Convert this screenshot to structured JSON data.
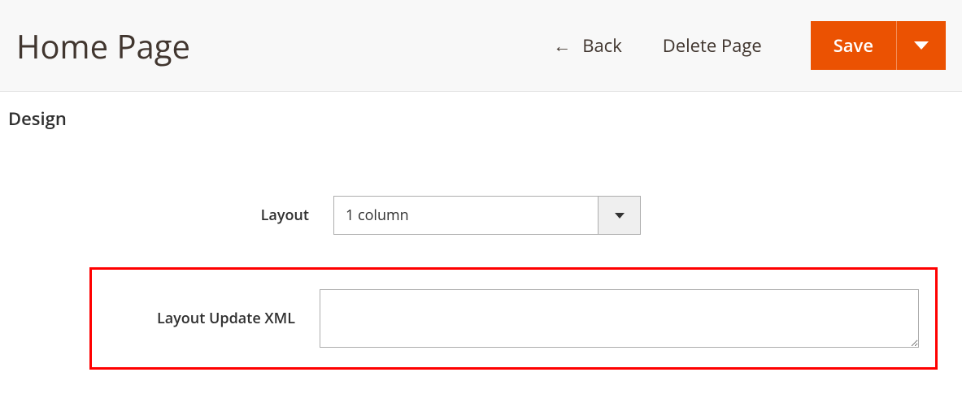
{
  "header": {
    "title": "Home Page",
    "back_label": "Back",
    "delete_label": "Delete Page",
    "save_label": "Save"
  },
  "section": {
    "title": "Design",
    "layout_label": "Layout",
    "layout_selected": "1 column",
    "layout_update_label": "Layout Update XML",
    "layout_update_value": ""
  }
}
